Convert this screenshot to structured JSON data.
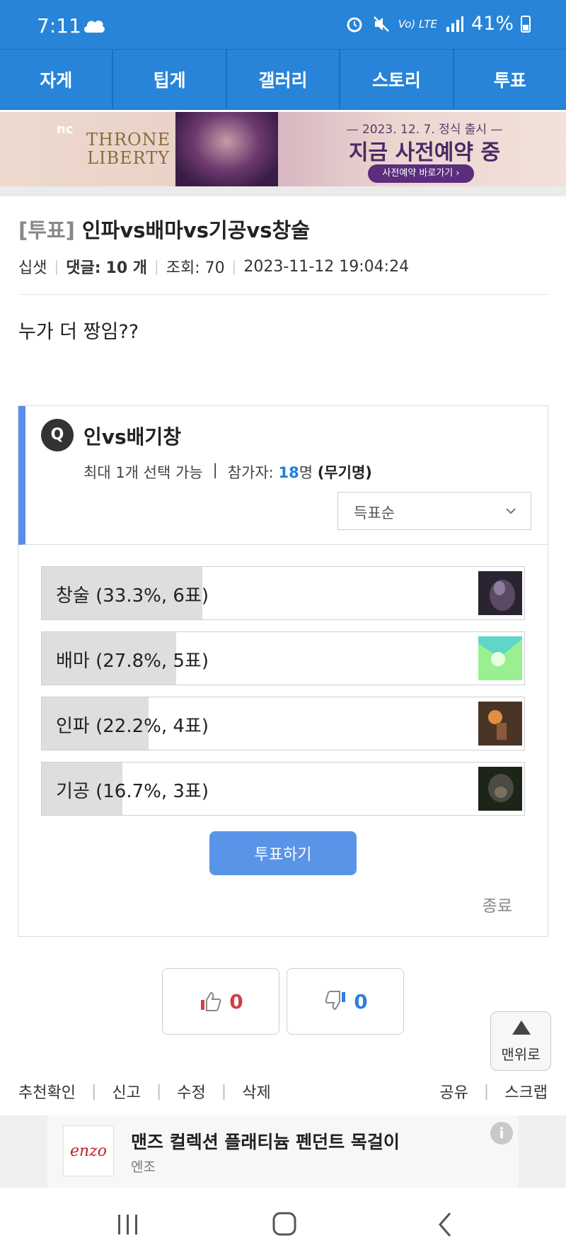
{
  "status_bar": {
    "time": "7:11",
    "network": "Vo) LTE",
    "battery": "41%"
  },
  "nav": {
    "tabs": [
      "자게",
      "팁게",
      "갤러리",
      "스토리",
      "투표"
    ]
  },
  "banner": {
    "brand": "nc",
    "logo_line1": "THRONE",
    "logo_line2": "LIBERTY",
    "date": "— 2023. 12. 7. 정식 출시 —",
    "headline": "지금 사전예약 중",
    "cta": "사전예약 바로가기 ›"
  },
  "post": {
    "category": "[투표]",
    "title": "인파vs배마vs기공vs창술",
    "author": "십샛",
    "comments_label": "댓글:",
    "comments_count": "10 개",
    "views": "조회: 70",
    "datetime": "2023-11-12 19:04:24",
    "body": "누가 더 짱임??"
  },
  "poll": {
    "q_badge": "Q",
    "question": "인vs배기창",
    "max_select": "최대 1개 선택 가능",
    "sep": "|",
    "participants_label": "참가자:",
    "participants_count": "18",
    "participants_unit": "명",
    "anonymous": "(무기명)",
    "sort_label": "득표순",
    "options": [
      {
        "label": "창술 (33.3%, 6표)",
        "percent": 33.3
      },
      {
        "label": "배마 (27.8%, 5표)",
        "percent": 27.8
      },
      {
        "label": "인파 (22.2%, 4표)",
        "percent": 22.2
      },
      {
        "label": "기공 (16.7%, 3표)",
        "percent": 16.7
      }
    ],
    "vote_button": "투표하기",
    "close_label": "종료"
  },
  "reactions": {
    "up_count": "0",
    "down_count": "0"
  },
  "top_button": "맨위로",
  "actions": {
    "left": [
      "추천확인",
      "신고",
      "수정",
      "삭제"
    ],
    "right": [
      "공유",
      "스크랩"
    ]
  },
  "ad": {
    "logo": "enzo",
    "title": "맨즈 컬렉션 플래티늄 펜던트 목걸이",
    "advertiser": "엔조",
    "info": "i"
  },
  "colors": {
    "brand_blue": "#2784d8",
    "poll_accent": "#5a8ee8",
    "up_red": "#d0413f",
    "down_blue": "#2f7fe0",
    "participant_blue": "#1e7fdc"
  }
}
